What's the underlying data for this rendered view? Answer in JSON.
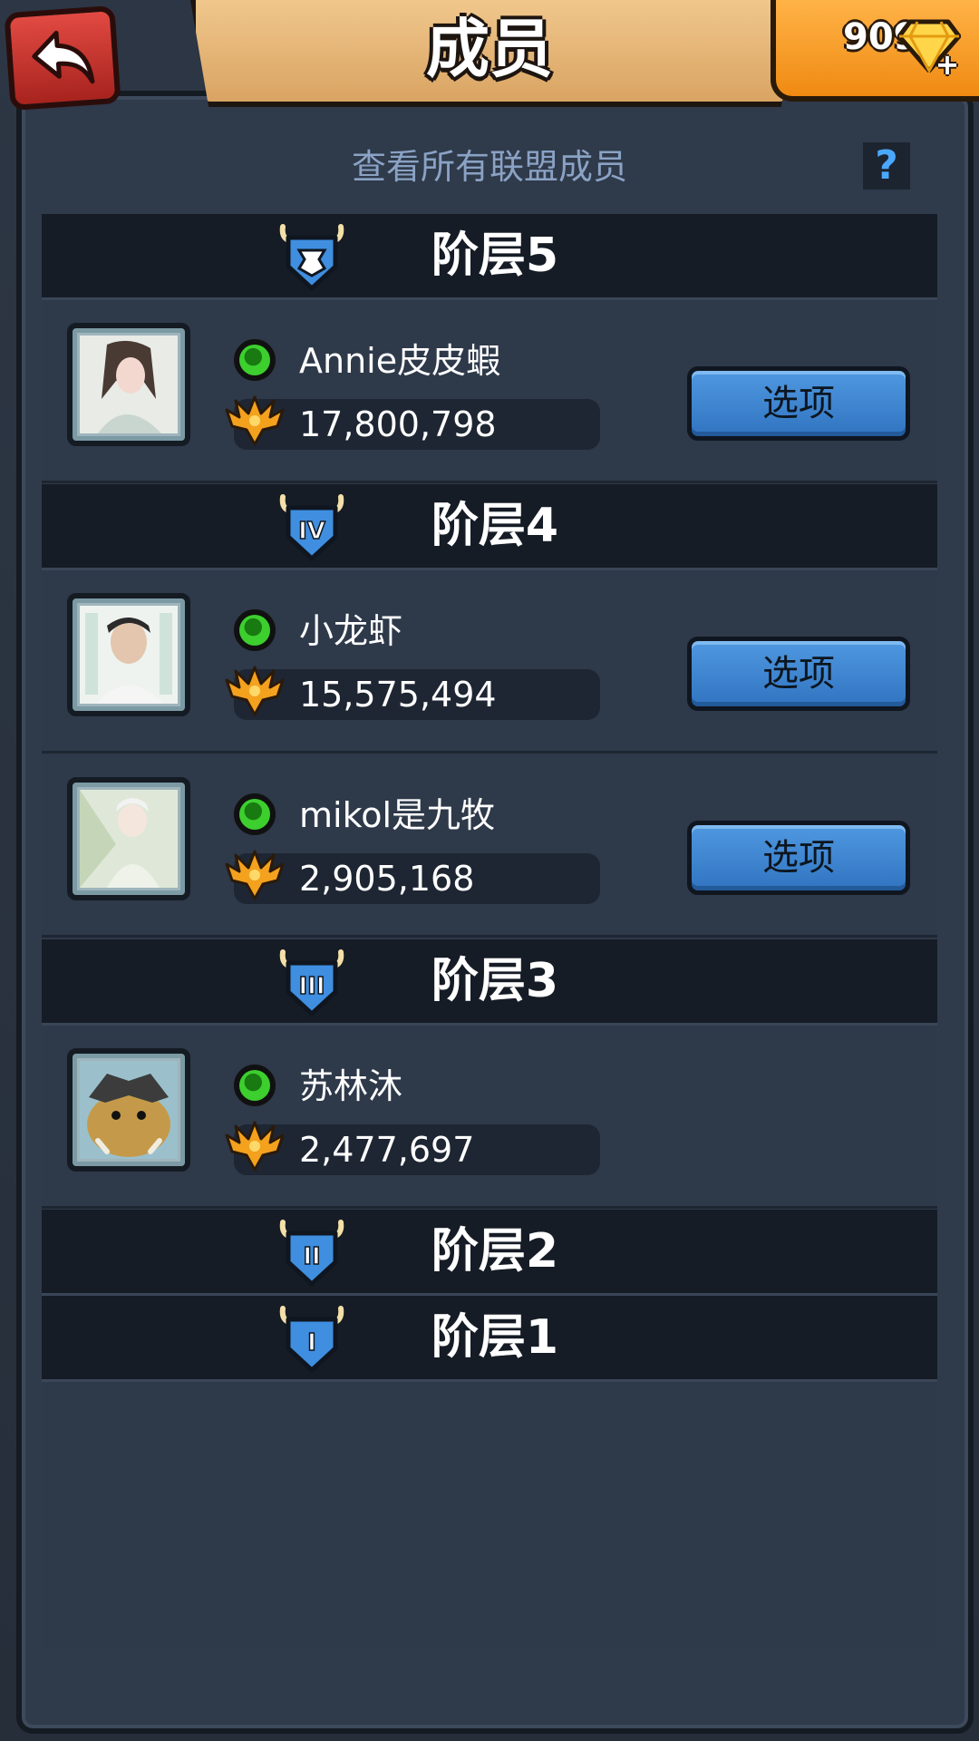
{
  "header": {
    "title": "成员",
    "gem_count": "909",
    "plus_symbol": "+",
    "back_icon": "back-arrow-icon",
    "gem_icon": "diamond-icon"
  },
  "subtitle": "查看所有联盟成员",
  "help_symbol": "?",
  "options_label": "选项",
  "colors": {
    "frame": "#2f3a4a",
    "tier_header_bg": "#161c26",
    "title_banner": "#e9b877",
    "gem_box": "#f5a02a",
    "back_button": "#c93730",
    "options_button": "#3f86d2",
    "online_green": "#3ccf2e",
    "subtitle_text": "#8aa2c4"
  },
  "tiers": [
    {
      "label": "阶层5",
      "badge": "crest"
    },
    {
      "label": "阶层4",
      "badge": "IV"
    },
    {
      "label": "阶层3",
      "badge": "III"
    },
    {
      "label": "阶层2",
      "badge": "II"
    },
    {
      "label": "阶层1",
      "badge": "I"
    }
  ],
  "members": [
    {
      "name": "Annie皮皮蝦",
      "score": "17,800,798",
      "online": true,
      "has_options": true
    },
    {
      "name": "小龙虾",
      "score": "15,575,494",
      "online": true,
      "has_options": true
    },
    {
      "name": "mikol是九牧",
      "score": "2,905,168",
      "online": true,
      "has_options": true
    },
    {
      "name": "苏林沐",
      "score": "2,477,697",
      "online": true,
      "has_options": false
    }
  ]
}
